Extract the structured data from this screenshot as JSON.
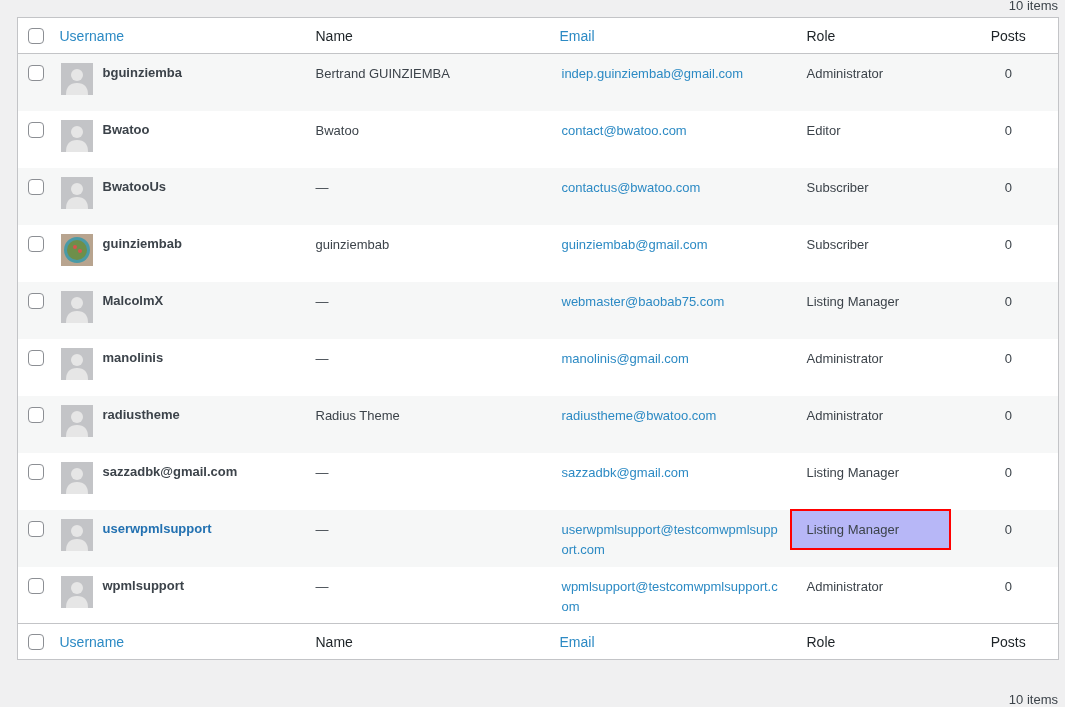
{
  "top_count": "10 items",
  "header": {
    "select_all_checked": false,
    "columns": [
      {
        "label": "Username",
        "sortable": true
      },
      {
        "label": "Name",
        "sortable": false
      },
      {
        "label": "Email",
        "sortable": true
      },
      {
        "label": "Role",
        "sortable": false
      },
      {
        "label": "Posts",
        "sortable": false
      }
    ]
  },
  "rows": [
    {
      "username": "bguinziemba",
      "name": "Bertrand GUINZIEMBA",
      "email": "indep.guinziembab@gmail.com",
      "role": "Administrator",
      "posts": "0",
      "avatar": {
        "kind": "default"
      },
      "hovered": false,
      "role_highlighted": false,
      "checked": false
    },
    {
      "username": "Bwatoo",
      "name": "Bwatoo",
      "email": "contact@bwatoo.com",
      "role": "Editor",
      "posts": "0",
      "avatar": {
        "kind": "default"
      },
      "hovered": false,
      "role_highlighted": false,
      "checked": false
    },
    {
      "username": "BwatooUs",
      "name": "—",
      "email": "contactus@bwatoo.com",
      "role": "Subscriber",
      "posts": "0",
      "avatar": {
        "kind": "default"
      },
      "hovered": false,
      "role_highlighted": false,
      "checked": false
    },
    {
      "username": "guinziembab",
      "name": "guinziembab",
      "email": "guinziembab@gmail.com",
      "role": "Subscriber",
      "posts": "0",
      "avatar": {
        "kind": "photo"
      },
      "hovered": false,
      "role_highlighted": false,
      "checked": false
    },
    {
      "username": "MalcolmX",
      "name": "—",
      "email": "webmaster@baobab75.com",
      "role": "Listing Manager",
      "posts": "0",
      "avatar": {
        "kind": "default"
      },
      "hovered": false,
      "role_highlighted": false,
      "checked": false
    },
    {
      "username": "manolinis",
      "name": "—",
      "email": "manolinis@gmail.com",
      "role": "Administrator",
      "posts": "0",
      "avatar": {
        "kind": "default"
      },
      "hovered": false,
      "role_highlighted": false,
      "checked": false
    },
    {
      "username": "radiustheme",
      "name": "Radius Theme",
      "email": "radiustheme@bwatoo.com",
      "role": "Administrator",
      "posts": "0",
      "avatar": {
        "kind": "default"
      },
      "hovered": false,
      "role_highlighted": false,
      "checked": false
    },
    {
      "username": "sazzadbk@gmail.com",
      "name": "—",
      "email": "sazzadbk@gmail.com",
      "role": "Listing Manager",
      "posts": "0",
      "avatar": {
        "kind": "default"
      },
      "hovered": false,
      "role_highlighted": false,
      "checked": false
    },
    {
      "username": "userwpmlsupport",
      "name": "—",
      "email": "userwpmlsupport@testcomwpmlsupport.com",
      "role": "Listing Manager",
      "posts": "0",
      "avatar": {
        "kind": "default"
      },
      "hovered": true,
      "role_highlighted": true,
      "checked": false
    },
    {
      "username": "wpmlsupport",
      "name": "—",
      "email": "wpmlsupport@testcomwpmlsupport.com",
      "role": "Administrator",
      "posts": "0",
      "avatar": {
        "kind": "default"
      },
      "hovered": false,
      "role_highlighted": false,
      "checked": false
    }
  ],
  "footer": {
    "select_all_checked": false,
    "columns": [
      {
        "label": "Username",
        "sortable": true
      },
      {
        "label": "Name",
        "sortable": false
      },
      {
        "label": "Email",
        "sortable": true
      },
      {
        "label": "Role",
        "sortable": false
      },
      {
        "label": "Posts",
        "sortable": false
      }
    ]
  },
  "bottom_count": "10 items"
}
